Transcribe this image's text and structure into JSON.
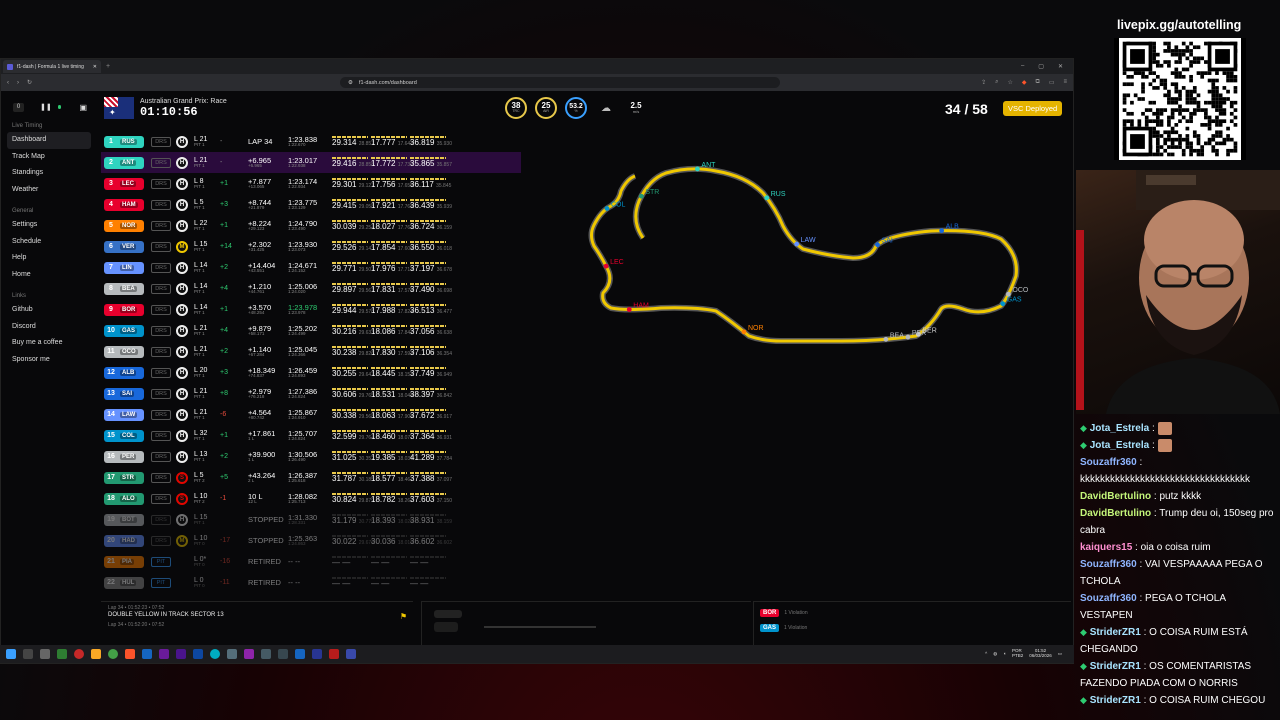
{
  "stream": {
    "livepix": "livepix.gg/autotelling"
  },
  "browser": {
    "tab_title": "f1-dash | Formula 1 live timing",
    "url": "f1-dash.com/dashboard"
  },
  "sidebar": {
    "sections": [
      {
        "label": "Live Timing",
        "items": [
          "Dashboard",
          "Track Map",
          "Standings",
          "Weather"
        ]
      },
      {
        "label": "General",
        "items": [
          "Settings",
          "Schedule",
          "Help",
          "Home"
        ]
      },
      {
        "label": "Links",
        "items": [
          "Github",
          "Discord",
          "Buy me a coffee",
          "Sponsor me"
        ]
      }
    ],
    "active": "Dashboard",
    "delay_value": "0"
  },
  "header": {
    "race_title": "Australian Grand Prix: Race",
    "session_time": "01:10:56",
    "track_temp": "38",
    "track_temp_label": "TRC",
    "air_temp": "25",
    "air_temp_label": "AIR",
    "humidity": "53.2",
    "humidity_label": "%",
    "wind_speed": "2.5",
    "wind_unit": "m/s",
    "lap_count": "34 / 58",
    "status_badge": "VSC Deployed"
  },
  "colors": {
    "RUS": "#2fd4c0",
    "ANT": "#2fd4c0",
    "LEC": "#e8002d",
    "HAM": "#e8002d",
    "NOR": "#ff8000",
    "VER": "#3671c6",
    "LIN": "#6692ff",
    "BEA": "#b6babd",
    "BOR": "#e8002d",
    "GAS": "#0093cc",
    "OCO": "#b6babd",
    "ALB": "#1868db",
    "SAI": "#1868db",
    "LAW": "#6692ff",
    "COL": "#0093cc",
    "PER": "#b6babd",
    "STR": "#229971",
    "ALO": "#229971",
    "BOT": "#b6babd",
    "HAD": "#6692ff",
    "PIA": "#ff8000"
  },
  "drivers": [
    {
      "pos": "1",
      "code": "RUS",
      "drs": "DRS",
      "tyre": "H",
      "lap": "L 21",
      "lap_sub": "PIT 1",
      "gained": "-",
      "gap": "LAP 34",
      "gap_sub": "",
      "best": "1:23.838",
      "best_sub": "1:22.670",
      "s1": "29.314",
      "s1b": "28.857",
      "s2": "17.777",
      "s2b": "17.643",
      "s3": "36.819",
      "s3b": "35.930"
    },
    {
      "pos": "2",
      "code": "ANT",
      "drs": "DRS",
      "tyre": "H",
      "lap": "L 21",
      "lap_sub": "PIT 1",
      "gained": "-",
      "gap": "+6.965",
      "gap_sub": "+6.965",
      "best": "1:23.017",
      "best_sub": "1:22.938",
      "s1": "29.416",
      "s1b": "28.858",
      "s2": "17.772",
      "s2b": "17.730",
      "s3": "35.865",
      "s3b": "35.857"
    },
    {
      "pos": "3",
      "code": "LEC",
      "drs": "DRS",
      "tyre": "H",
      "lap": "L 8",
      "lap_sub": "PIT 1",
      "gained": "+1",
      "gap": "+7.877",
      "gap_sub": "+13.065",
      "best": "1:23.174",
      "best_sub": "1:22.934",
      "s1": "29.301",
      "s1b": "29.127",
      "s2": "17.756",
      "s2b": "17.655",
      "s3": "36.117",
      "s3b": "35.845"
    },
    {
      "pos": "4",
      "code": "HAM",
      "drs": "DRS",
      "tyre": "H",
      "lap": "L 5",
      "lap_sub": "PIT 1",
      "gained": "+3",
      "gap": "+8.744",
      "gap_sub": "+21.879",
      "best": "1:23.775",
      "best_sub": "1:23.129",
      "s1": "29.415",
      "s1b": "29.058",
      "s2": "17.921",
      "s2b": "17.768",
      "s3": "36.439",
      "s3b": "35.939"
    },
    {
      "pos": "5",
      "code": "NOR",
      "drs": "DRS",
      "tyre": "H",
      "lap": "L 22",
      "lap_sub": "PIT 1",
      "gained": "+1",
      "gap": "+8.224",
      "gap_sub": "+29.123",
      "best": "1:24.790",
      "best_sub": "1:23.490",
      "s1": "30.039",
      "s1b": "29.254",
      "s2": "18.027",
      "s2b": "17.763",
      "s3": "36.724",
      "s3b": "36.159"
    },
    {
      "pos": "6",
      "code": "VER",
      "drs": "DRS",
      "tyre": "M",
      "lap": "L 15",
      "lap_sub": "PIT 1",
      "gained": "+14",
      "gap": "+2.302",
      "gap_sub": "+31.425",
      "best": "1:23.930",
      "best_sub": "1:23.073",
      "s1": "29.526",
      "s1b": "29.143",
      "s2": "17.854",
      "s2b": "17.609",
      "s3": "36.550",
      "s3b": "36.018"
    },
    {
      "pos": "7",
      "code": "LIN",
      "drs": "DRS",
      "tyre": "H",
      "lap": "L 14",
      "lap_sub": "PIT 1",
      "gained": "+2",
      "gap": "+14.404",
      "gap_sub": "+43.551",
      "best": "1:24.671",
      "best_sub": "1:24.152",
      "s1": "29.771",
      "s1b": "29.507",
      "s2": "17.976",
      "s2b": "17.713",
      "s3": "37.197",
      "s3b": "36.678"
    },
    {
      "pos": "8",
      "code": "BEA",
      "drs": "DRS",
      "tyre": "H",
      "lap": "L 14",
      "lap_sub": "PIT 1",
      "gained": "+4",
      "gap": "+1.210",
      "gap_sub": "+44.761",
      "best": "1:25.006",
      "best_sub": "1:24.020",
      "s1": "29.897",
      "s1b": "29.567",
      "s2": "17.831",
      "s2b": "17.578",
      "s3": "37.490",
      "s3b": "36.698"
    },
    {
      "pos": "9",
      "code": "BOR",
      "drs": "DRS",
      "tyre": "H",
      "lap": "L 14",
      "lap_sub": "PIT 1",
      "gained": "+1",
      "gap": "+3.570",
      "gap_sub": "+48.254",
      "best": "1:23.978",
      "best_sub": "1:23.978",
      "s1": "29.944",
      "s1b": "29.578",
      "s2": "17.988",
      "s2b": "17.824",
      "s3": "36.513",
      "s3b": "36.477"
    },
    {
      "pos": "10",
      "code": "GAS",
      "drs": "DRS",
      "tyre": "H",
      "lap": "L 21",
      "lap_sub": "PIT 1",
      "gained": "+4",
      "gap": "+9.879",
      "gap_sub": "+58.171",
      "best": "1:25.202",
      "best_sub": "1:24.499",
      "s1": "30.216",
      "s1b": "29.633",
      "s2": "18.086",
      "s2b": "17.847",
      "s3": "37.056",
      "s3b": "36.638"
    },
    {
      "pos": "11",
      "code": "OCO",
      "drs": "DRS",
      "tyre": "H",
      "lap": "L 21",
      "lap_sub": "PIT 1",
      "gained": "+2",
      "gap": "+1.140",
      "gap_sub": "+67.284",
      "best": "1:25.045",
      "best_sub": "1:24.366",
      "s1": "30.238",
      "s1b": "29.826",
      "s2": "17.830",
      "s2b": "17.593",
      "s3": "37.106",
      "s3b": "36.354"
    },
    {
      "pos": "12",
      "code": "ALB",
      "drs": "DRS",
      "tyre": "H",
      "lap": "L 20",
      "lap_sub": "PIT 1",
      "gained": "+3",
      "gap": "+18.349",
      "gap_sub": "+74.837",
      "best": "1:26.459",
      "best_sub": "1:24.893",
      "s1": "30.255",
      "s1b": "29.647",
      "s2": "18.445",
      "s2b": "18.153",
      "s3": "37.749",
      "s3b": "36.949"
    },
    {
      "pos": "13",
      "code": "SAI",
      "drs": "DRS",
      "tyre": "H",
      "lap": "L 21",
      "lap_sub": "PIT 1",
      "gained": "+8",
      "gap": "+2.979",
      "gap_sub": "+76.218",
      "best": "1:27.386",
      "best_sub": "1:24.824",
      "s1": "30.606",
      "s1b": "29.765",
      "s2": "18.531",
      "s2b": "18.048",
      "s3": "38.397",
      "s3b": "36.842"
    },
    {
      "pos": "14",
      "code": "LAW",
      "drs": "DRS",
      "tyre": "H",
      "lap": "L 21",
      "lap_sub": "PIT 1",
      "gained": "-6",
      "gap": "+4.564",
      "gap_sub": "+80.742",
      "best": "1:25.867",
      "best_sub": "1:24.910",
      "s1": "30.338",
      "s1b": "29.568",
      "s2": "18.063",
      "s2b": "17.908",
      "s3": "37.672",
      "s3b": "36.917"
    },
    {
      "pos": "15",
      "code": "COL",
      "drs": "DRS",
      "tyre": "H",
      "lap": "L 32",
      "lap_sub": "PIT 1",
      "gained": "+1",
      "gap": "+17.861",
      "gap_sub": "1 L",
      "best": "1:25.707",
      "best_sub": "1:24.824",
      "s1": "32.599",
      "s1b": "29.764",
      "s2": "18.460",
      "s2b": "18.077",
      "s3": "37.364",
      "s3b": "36.931"
    },
    {
      "pos": "16",
      "code": "PER",
      "drs": "DRS",
      "tyre": "H",
      "lap": "L 13",
      "lap_sub": "PIT 1",
      "gained": "+2",
      "gap": "+39.900",
      "gap_sub": "1 L",
      "best": "1:30.506",
      "best_sub": "1:26.490",
      "s1": "31.025",
      "s1b": "30.352",
      "s2": "19.385",
      "s2b": "18.037",
      "s3": "41.289",
      "s3b": "37.784"
    },
    {
      "pos": "17",
      "code": "STR",
      "drs": "DRS",
      "tyre": "S",
      "lap": "L 5",
      "lap_sub": "PIT 2",
      "gained": "+5",
      "gap": "+43.264",
      "gap_sub": "2 L",
      "best": "1:26.387",
      "best_sub": "1:25.618",
      "s1": "31.787",
      "s1b": "30.185",
      "s2": "18.577",
      "s2b": "18.467",
      "s3": "37.388",
      "s3b": "37.097"
    },
    {
      "pos": "18",
      "code": "ALO",
      "drs": "DRS",
      "tyre": "S",
      "lap": "L 10",
      "lap_sub": "PIT 2",
      "gained": "-1",
      "gap": "10 L",
      "gap_sub": "12 L",
      "best": "1:28.082",
      "best_sub": "1:25.713",
      "s1": "30.824",
      "s1b": "29.879",
      "s2": "18.782",
      "s2b": "18.262",
      "s3": "37.603",
      "s3b": "37.150"
    },
    {
      "pos": "19",
      "code": "BOT",
      "drs": "DRS",
      "tyre": "H",
      "lap": "L 15",
      "lap_sub": "PIT 1",
      "gained": "",
      "gap": "STOPPED",
      "gap_sub": "",
      "best": "1:31.330",
      "best_sub": "1:28.331",
      "s1": "31.179",
      "s1b": "30.779",
      "s2": "18.393",
      "s2b": "18.025",
      "s3": "38.931",
      "s3b": "38.159",
      "dim": true
    },
    {
      "pos": "20",
      "code": "HAD",
      "drs": "DRS",
      "tyre": "M",
      "lap": "L 10",
      "lap_sub": "PIT 0",
      "gained": "-17",
      "gap": "STOPPED",
      "gap_sub": "",
      "best": "1:25.363",
      "best_sub": "1:24.863",
      "s1": "30.022",
      "s1b": "29.676",
      "s2": "30.036",
      "s2b": "18.016",
      "s3": "36.602",
      "s3b": "36.602",
      "dim": true
    },
    {
      "pos": "21",
      "code": "PIA",
      "drs": "PIT",
      "tyre": "",
      "lap": "L 0*",
      "lap_sub": "PIT 0",
      "gained": "-16",
      "gap": "RETIRED",
      "gap_sub": "",
      "best": "-- --",
      "best_sub": "",
      "s1": "",
      "s1b": "",
      "s2": "",
      "s2b": "",
      "s3": "",
      "s3b": "",
      "dim": true
    },
    {
      "pos": "22",
      "code": "HUL",
      "drs": "PIT",
      "tyre": "",
      "lap": "L 0",
      "lap_sub": "PIT 0",
      "gained": "-11",
      "gap": "RETIRED",
      "gap_sub": "",
      "best": "-- --",
      "best_sub": "",
      "s1": "",
      "s1b": "",
      "s2": "",
      "s2b": "",
      "s3": "",
      "s3b": "",
      "dim": true
    }
  ],
  "track_labels": [
    "ANT",
    "RUS",
    "STR",
    "COL",
    "LAW",
    "LEC",
    "ALB",
    "SAI",
    "OCO",
    "GAS",
    "HAM",
    "NOR",
    "BER",
    "PER",
    "BEA"
  ],
  "race_control": {
    "entries": [
      {
        "time": "Lap 34 • 01:52:23 • 07:52",
        "message": "DOUBLE YELLOW IN TRACK SECTOR 13"
      },
      {
        "time": "Lap 34 • 01:52:20 • 07:52",
        "message": ""
      }
    ]
  },
  "violations": [
    {
      "code": "BOR",
      "label": "1 Violation"
    },
    {
      "code": "GAS",
      "label": "1 Violation"
    }
  ],
  "taskbar": {
    "lang": "POR",
    "lang2": "PTB2",
    "clock": "01:52",
    "date": "06/03/2026"
  },
  "chat": [
    {
      "user": "Jota_Estrela",
      "badge": true,
      "text": "",
      "user_color": "#a9e4ff"
    },
    {
      "user": "Jota_Estrela",
      "badge": true,
      "text": "",
      "user_color": "#a9e4ff"
    },
    {
      "user": "Souzaffr360",
      "badge": false,
      "text": "kkkkkkkkkkkkkkkkkkkkkkkkkkkkkkkkkk",
      "user_color": "#8fb5ff"
    },
    {
      "user": "DavidBertulino",
      "badge": false,
      "text": "putz kkkk",
      "user_color": "#c4f57a"
    },
    {
      "user": "DavidBertulino",
      "badge": false,
      "text": "Trump deu oi, 150seg pro cabra",
      "user_color": "#c4f57a"
    },
    {
      "user": "kaiquers15",
      "badge": false,
      "text": "oia o coisa ruim",
      "user_color": "#ff8fd0"
    },
    {
      "user": "Souzaffr360",
      "badge": false,
      "text": "VAI VESPAAAAA PEGA O TCHOLA",
      "user_color": "#8fb5ff"
    },
    {
      "user": "Souzaffr360",
      "badge": false,
      "text": "PEGA O TCHOLA VESTAPEN",
      "user_color": "#8fb5ff"
    },
    {
      "user": "StriderZR1",
      "badge": true,
      "text": "O COISA RUIM ESTÁ CHEGANDO",
      "user_color": "#a9e4ff"
    },
    {
      "user": "StriderZR1",
      "badge": true,
      "text": "OS COMENTARISTAS FAZENDO PIADA COM O NORRIS",
      "user_color": "#a9e4ff"
    },
    {
      "user": "StriderZR1",
      "badge": true,
      "text": "O COISA RUIM CHEGOU",
      "user_color": "#a9e4ff"
    }
  ]
}
